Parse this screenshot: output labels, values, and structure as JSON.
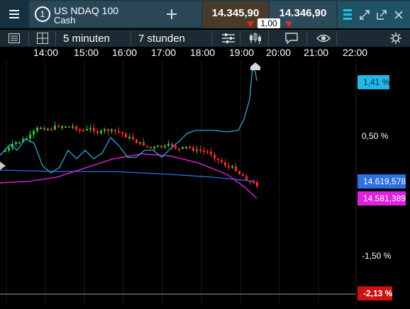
{
  "instrument": {
    "number": "1",
    "name": "US NDAQ 100",
    "subname": "Cash"
  },
  "quote": {
    "sell_price": "14.345,90",
    "buy_price": "14.346,90",
    "quantity": "1,00"
  },
  "toolbar": {
    "interval": "5 minuten",
    "range": "7 stunden"
  },
  "time_axis": [
    "14:00",
    "15:00",
    "16:00",
    "17:00",
    "18:00",
    "19:00",
    "20:00",
    "21:00",
    "22:00"
  ],
  "price_axis": [
    "0,50 %",
    "-1,50 %"
  ],
  "tags": {
    "comparison": "1,41 %",
    "ma_blue": "14.619,578",
    "ma_magenta": "14.581,389",
    "change": "-2,13 %"
  },
  "colors": {
    "up": "#22cc22",
    "down": "#ff2222",
    "compare_line": "#2aa7d8",
    "ma_blue": "#2f6fe0",
    "ma_magenta": "#d020c8",
    "change_tag": "#cc1111"
  }
}
